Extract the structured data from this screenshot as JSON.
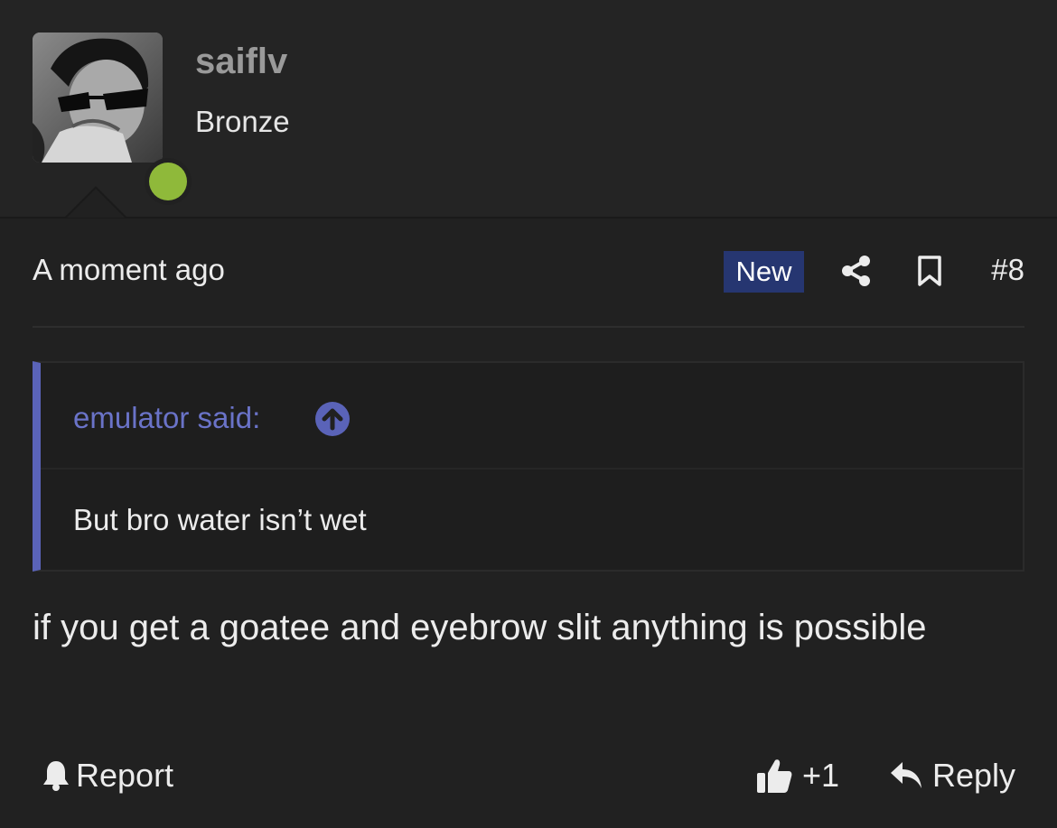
{
  "author": {
    "username": "saiflv",
    "title": "Bronze",
    "online": true,
    "online_color": "#8fb93a"
  },
  "post": {
    "timestamp": "A moment ago",
    "badge": "New",
    "badge_color": "#263671",
    "number": "#8",
    "icons": [
      "share-icon",
      "bookmark-icon"
    ]
  },
  "quote": {
    "author_label": "emulator said:",
    "accent_color": "#5a63b8",
    "body": "But bro water isn’t wet"
  },
  "message": "if you get a goatee and eyebrow slit anything is possible",
  "actions": {
    "report_label": "Report",
    "like_count": "+1",
    "reply_label": "Reply"
  }
}
